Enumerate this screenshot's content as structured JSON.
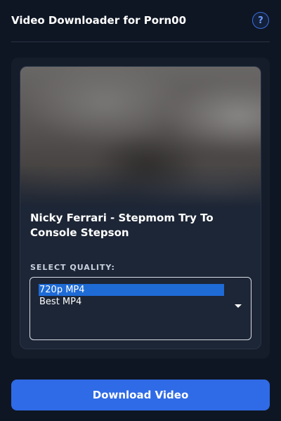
{
  "header": {
    "title": "Video Downloader for Porn00",
    "help_label": "?"
  },
  "video": {
    "title": "Nicky Ferrari - Stepmom Try To Console Stepson",
    "thumbnail": "blurred-video-thumbnail"
  },
  "quality": {
    "label": "SELECT QUALITY:",
    "options": [
      "720p MP4",
      "Best MP4"
    ],
    "selected": "720p MP4"
  },
  "actions": {
    "download_label": "Download Video"
  },
  "colors": {
    "background": "#0f1623",
    "panel": "#151d2b",
    "card": "#1d2636",
    "accent": "#2f6be6",
    "selected_option": "#1e6bd6",
    "help_ring": "#3b6fe0"
  }
}
